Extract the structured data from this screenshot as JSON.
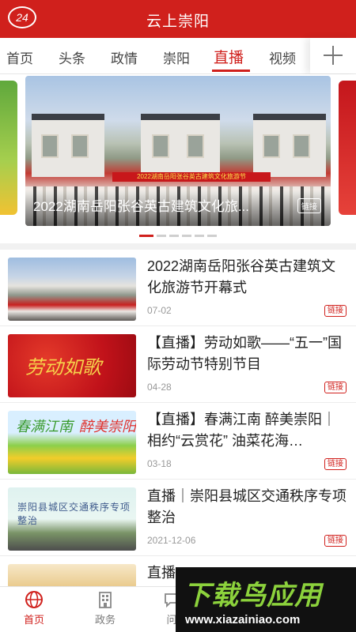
{
  "header": {
    "logo_text": "24",
    "title": "云上崇阳"
  },
  "tabs": [
    {
      "label": "首页"
    },
    {
      "label": "头条"
    },
    {
      "label": "政情"
    },
    {
      "label": "崇阳"
    },
    {
      "label": "直播"
    },
    {
      "label": "视频"
    }
  ],
  "active_tab": "直播",
  "carousel": {
    "caption": "2022湖南岳阳张谷英古建筑文化旅...",
    "badge": "链接",
    "stage_banner": "2022湖南岳阳张谷英古建筑文化旅游节",
    "slide_count": 6,
    "active_slide": 1
  },
  "news": [
    {
      "title": "2022湖南岳阳张谷英古建筑文化旅游节开幕式",
      "date": "07-02",
      "tag": "链接"
    },
    {
      "title": "【直播】劳动如歌——“五一”国际劳动节特别节目",
      "date": "04-28",
      "tag": "链接",
      "thumb_text": "劳动如歌"
    },
    {
      "title": "【直播】春满江南 醉美崇阳｜相约“云赏花” 油菜花海…",
      "date": "03-18",
      "tag": "链接",
      "thumb_text_a": "春满江南",
      "thumb_text_b": "醉美崇阳"
    },
    {
      "title": "直播｜崇阳县城区交通秩序专项整治",
      "date": "2021-12-06",
      "tag": "链接",
      "thumb_text": "崇阳县城区交通秩序专项整治"
    },
    {
      "title": "直播"
    }
  ],
  "bottom_nav": [
    {
      "label": "首页",
      "icon": "globe-icon"
    },
    {
      "label": "政务",
      "icon": "building-icon"
    },
    {
      "label": "问",
      "icon": "chat-icon"
    }
  ],
  "watermark": {
    "text": "下载鸟应用",
    "url": "www.xiazainiao.com"
  },
  "colors": {
    "brand_red": "#d0201c"
  }
}
